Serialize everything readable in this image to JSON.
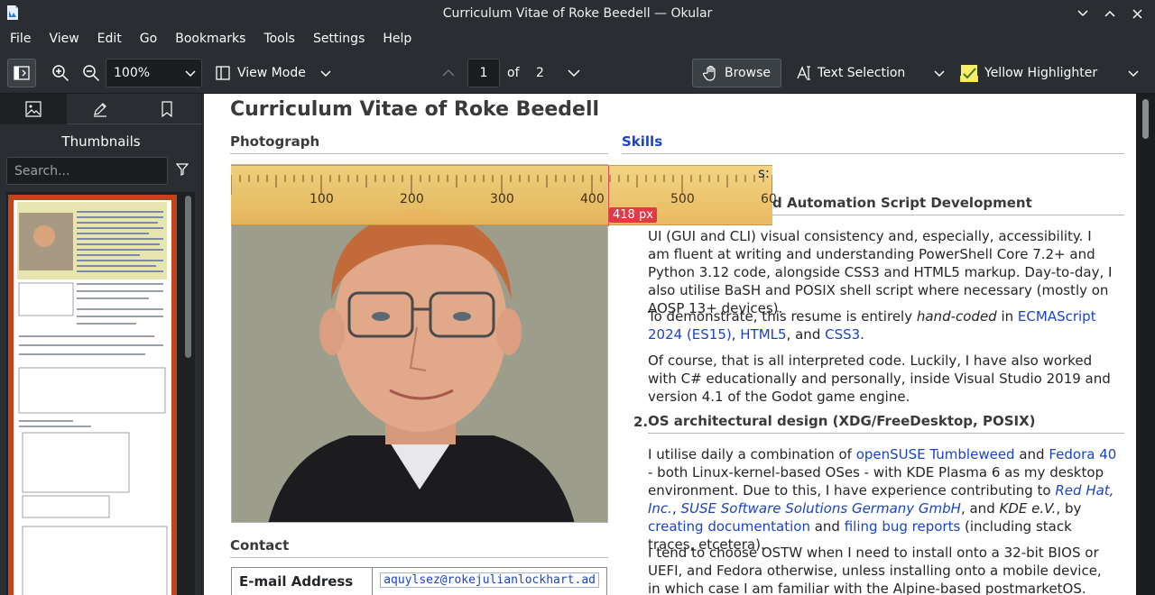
{
  "window": {
    "title": "Curriculum Vitae of Roke Beedell — Okular"
  },
  "menu": [
    "File",
    "View",
    "Edit",
    "Go",
    "Bookmarks",
    "Tools",
    "Settings",
    "Help"
  ],
  "toolbar": {
    "zoom_value": "100%",
    "view_mode_label": "View Mode",
    "page_current": "1",
    "page_of_label": "of",
    "page_total": "2",
    "browse_label": "Browse",
    "text_selection_label": "Text Selection",
    "highlighter_label": "Yellow Highlighter"
  },
  "sidebar": {
    "title": "Thumbnails",
    "search_placeholder": "Search..."
  },
  "document": {
    "heading": "Curriculum Vitae of Roke Beedell",
    "photo_section": "Photograph",
    "skills_section": "Skills",
    "contact_section": "Contact",
    "skills_intro_partial": "s:",
    "item1_title_partial": "d Automation Script Development",
    "item1_p1": "UI (GUI and CLI) visual consistency and, especially, accessibility. I am fluent at writing and understanding PowerShell Core 7.2+ and Python 3.12 code, alongside CSS3 and HTML5 markup. Day-to-day, I also utilise BaSH and POSIX shell script where necessary (mostly on AOSP 13+ devices).",
    "item1_p2_a": "To demonstrate, this resume is entirely ",
    "item1_p2_italic": "hand-coded",
    "item1_p2_b": " in ",
    "item1_p2_link1": "ECMAScript 2024 (ES15)",
    "item1_p2_c": ", ",
    "item1_p2_link2": "HTML5",
    "item1_p2_d": ", and ",
    "item1_p2_link3": "CSS3",
    "item1_p2_e": ".",
    "item1_p3": "Of course, that is all interpreted code. Luckily, I have also worked with C# educationally and personally, inside Visual Studio 2019 and version 4.1 of the Godot game engine.",
    "item2_number": "2.",
    "item2_title": "OS architectural design (XDG/FreeDesktop, POSIX)",
    "item2_p1_a": "I utilise daily a combination of ",
    "item2_p1_link1": "openSUSE Tumbleweed",
    "item2_p1_b": " and ",
    "item2_p1_link2": "Fedora 40",
    "item2_p1_c": " - both Linux-kernel-based OSes - with KDE Plasma 6 as my desktop environment. Due to this, I have experience contributing to ",
    "item2_p1_link3": "Red Hat, Inc.",
    "item2_p1_d": ", ",
    "item2_p1_link4": "SUSE Software Solutions Germany GmbH",
    "item2_p1_e": ", and ",
    "item2_p1_italic": "KDE e.V.",
    "item2_p1_f": ", by ",
    "item2_p1_link5": "creating documentation",
    "item2_p1_g": " and ",
    "item2_p1_link6": "filing bug reports",
    "item2_p1_h": " (including stack traces, etcetera).",
    "item2_p2": "I tend to choose OSTW when I need to install onto a 32-bit BIOS or UEFI, and Fedora otherwise, unless installing onto a mobile device, in which case I am familiar with the Alpine-based postmarketOS.",
    "contact_key": "E-mail Address",
    "contact_value": "aquylsez@rokejulianlockhart.ad"
  },
  "ruler": {
    "ticks": [
      "100",
      "200",
      "300",
      "400",
      "500",
      "60"
    ],
    "measure_label": "418 px"
  }
}
